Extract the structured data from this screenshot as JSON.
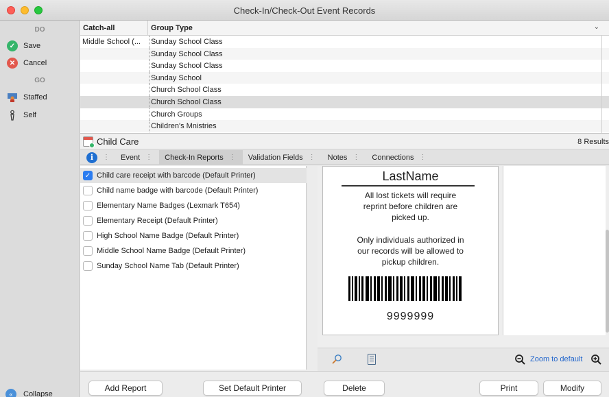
{
  "window": {
    "title": "Check-In/Check-Out Event Records"
  },
  "sidebar": {
    "do_header": "DO",
    "go_header": "GO",
    "save": "Save",
    "cancel": "Cancel",
    "staffed": "Staffed",
    "self": "Self",
    "collapse": "Collapse"
  },
  "grid": {
    "columns": [
      "Catch-all",
      "Group Type"
    ],
    "rows": [
      {
        "catch_all": "Middle School (...",
        "group_type": "Sunday School Class"
      },
      {
        "catch_all": "",
        "group_type": "Sunday School Class"
      },
      {
        "catch_all": "",
        "group_type": "Sunday School Class"
      },
      {
        "catch_all": "",
        "group_type": "Sunday School"
      },
      {
        "catch_all": "",
        "group_type": "Church School Class"
      },
      {
        "catch_all": "",
        "group_type": "Church School Class",
        "selected": true
      },
      {
        "catch_all": "",
        "group_type": "Church Groups"
      },
      {
        "catch_all": "",
        "group_type": "Children's Mnistries"
      }
    ]
  },
  "group": {
    "name": "Child Care",
    "results": "8 Results"
  },
  "tabs": [
    "Event",
    "Check-In Reports",
    "Validation Fields",
    "Notes",
    "Connections"
  ],
  "active_tab": "Check-In Reports",
  "reports": [
    {
      "label": "Child care receipt with barcode (Default Printer)",
      "checked": true
    },
    {
      "label": "Child name badge with barcode (Default Printer)",
      "checked": false
    },
    {
      "label": "Elementary Name Badges (Lexmark T654)",
      "checked": false
    },
    {
      "label": "Elementary Receipt (Default Printer)",
      "checked": false
    },
    {
      "label": "High School Name Badge (Default Printer)",
      "checked": false
    },
    {
      "label": "Middle School Name Badge (Default Printer)",
      "checked": false
    },
    {
      "label": "Sunday School Name Tab (Default Printer)",
      "checked": false
    }
  ],
  "preview": {
    "name": "LastName",
    "msg1": [
      "All lost tickets will require",
      "reprint before children are",
      "picked up."
    ],
    "msg2": [
      "Only individuals authorized in",
      "our records will be allowed to",
      "pickup children."
    ],
    "barcode_number": "9999999",
    "zoom_default": "Zoom to default"
  },
  "buttons": {
    "add_report": "Add Report",
    "set_default_printer": "Set Default Printer",
    "delete": "Delete",
    "print": "Print",
    "modify": "Modify"
  },
  "colors": {
    "accent": "#2b7cf0",
    "link": "#2266cc",
    "info": "#1f6fd1"
  }
}
